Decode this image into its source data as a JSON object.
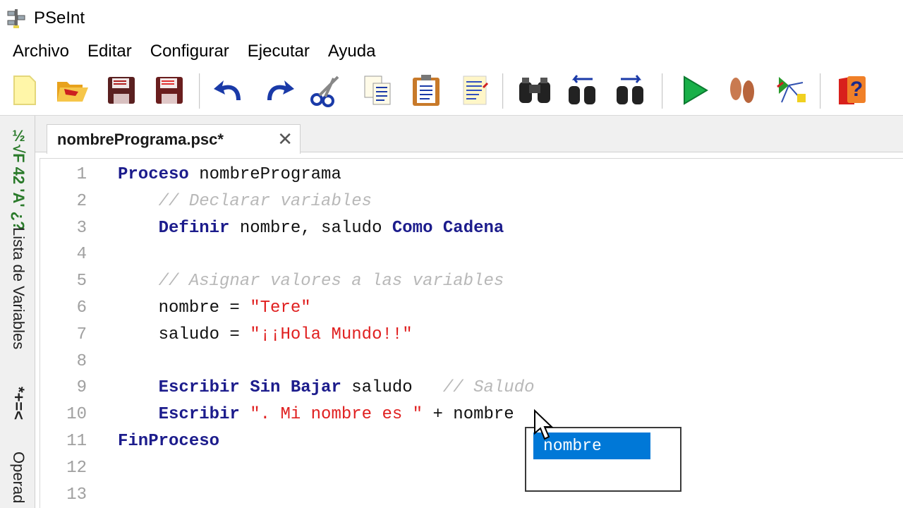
{
  "window": {
    "title": "PSeInt"
  },
  "menu": [
    "Archivo",
    "Editar",
    "Configurar",
    "Ejecutar",
    "Ayuda"
  ],
  "toolbar": {
    "buttons": [
      "new-file-icon",
      "open-folder-icon",
      "save-icon",
      "save-as-icon",
      "undo-icon",
      "redo-icon",
      "cut-icon",
      "copy-icon",
      "paste-icon",
      "edit-notes-icon",
      "find-icon",
      "find-previous-icon",
      "find-next-icon",
      "run-icon",
      "step-by-step-icon",
      "diagram-icon",
      "help-icon"
    ]
  },
  "side_panel": {
    "symbols_top": "½√F 42 'A' ¿?",
    "variables_label": "Lista de Variables",
    "operators_symbols": "*+=<",
    "operators_label": "Operad"
  },
  "tab": {
    "label": "nombrePrograma.psc*",
    "close": "✕"
  },
  "editor": {
    "lines": [
      {
        "n": "1",
        "tokens": [
          [
            "kw",
            "Proceso"
          ],
          [
            "id",
            " nombrePrograma"
          ]
        ]
      },
      {
        "n": "2",
        "tokens": [
          [
            "id",
            "    "
          ],
          [
            "cmt",
            "// Declarar variables"
          ]
        ]
      },
      {
        "n": "3",
        "tokens": [
          [
            "id",
            "    "
          ],
          [
            "kw",
            "Definir"
          ],
          [
            "id",
            " nombre, saludo "
          ],
          [
            "kw",
            "Como"
          ],
          [
            "id",
            " "
          ],
          [
            "kw",
            "Cadena"
          ]
        ]
      },
      {
        "n": "4",
        "tokens": []
      },
      {
        "n": "5",
        "tokens": [
          [
            "id",
            "    "
          ],
          [
            "cmt",
            "// Asignar valores a las variables"
          ]
        ]
      },
      {
        "n": "6",
        "tokens": [
          [
            "id",
            "    nombre = "
          ],
          [
            "str",
            "\"Tere\""
          ]
        ]
      },
      {
        "n": "7",
        "tokens": [
          [
            "id",
            "    saludo = "
          ],
          [
            "str",
            "\"¡¡Hola Mundo!!\""
          ]
        ]
      },
      {
        "n": "8",
        "tokens": []
      },
      {
        "n": "9",
        "tokens": [
          [
            "id",
            "    "
          ],
          [
            "kw",
            "Escribir Sin Bajar"
          ],
          [
            "id",
            " saludo   "
          ],
          [
            "cmt",
            "// Saludo"
          ]
        ]
      },
      {
        "n": "10",
        "tokens": [
          [
            "id",
            "    "
          ],
          [
            "kw",
            "Escribir"
          ],
          [
            "id",
            " "
          ],
          [
            "str",
            "\". Mi nombre es \""
          ],
          [
            "id",
            " + nombre"
          ]
        ]
      },
      {
        "n": "11",
        "tokens": [
          [
            "kw",
            "FinProceso"
          ]
        ]
      },
      {
        "n": "12",
        "tokens": []
      },
      {
        "n": "13",
        "tokens": []
      }
    ]
  },
  "autocomplete": {
    "items": [
      "nombre"
    ]
  },
  "colors": {
    "keyword": "#1c1c8c",
    "string": "#e02020",
    "comment": "#b8b8b8",
    "selection": "#0078d7"
  }
}
